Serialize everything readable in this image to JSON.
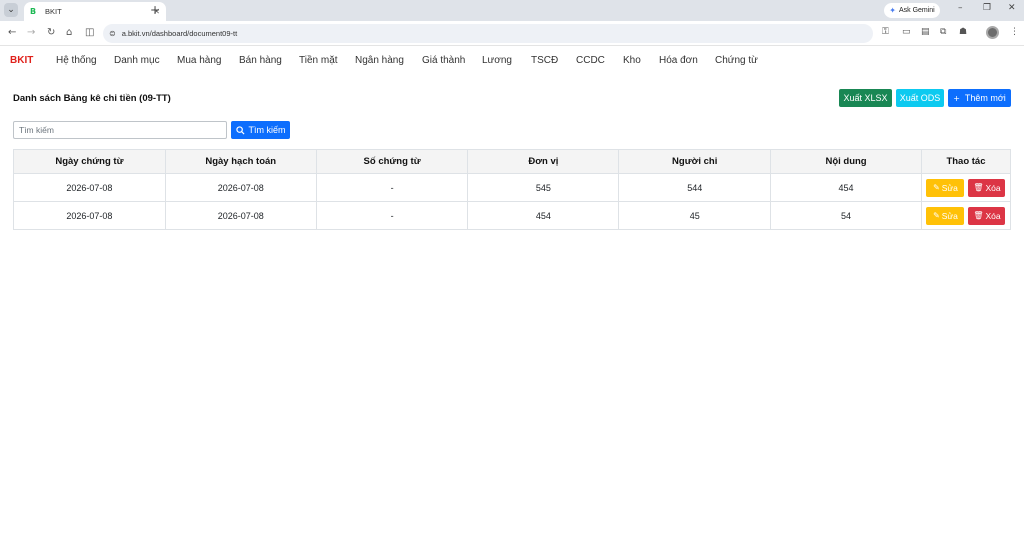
{
  "browser": {
    "tab_title": "BKIT",
    "favicon": "B",
    "url": "a.bkit.vn/dashboard/document09-tt",
    "gemini_label": "Ask Gemini"
  },
  "app": {
    "brand": "BKIT",
    "brand_color": "#e0211b",
    "menu": [
      "Hệ thống",
      "Danh mục",
      "Mua hàng",
      "Bán hàng",
      "Tiền mặt",
      "Ngân hàng",
      "Giá thành",
      "Lương",
      "TSCĐ",
      "CCDC",
      "Kho",
      "Hóa đơn",
      "Chứng từ"
    ]
  },
  "page": {
    "title": "Danh sách Bảng kê chi tiền (09-TT)",
    "export_xlsx": "Xuất XLSX",
    "export_ods": "Xuất ODS",
    "add_new": "Thêm mới",
    "search_placeholder": "Tìm kiếm",
    "search_button": "Tìm kiếm"
  },
  "table": {
    "headers": [
      "Ngày chứng từ",
      "Ngày hạch toán",
      "Số chứng từ",
      "Đơn vị",
      "Người chi",
      "Nội dung",
      "Thao tác"
    ],
    "rows": [
      [
        "2026-07-08",
        "2026-07-08",
        "-",
        "545",
        "544",
        "454"
      ],
      [
        "2026-07-08",
        "2026-07-08",
        "-",
        "454",
        "45",
        "54"
      ]
    ],
    "edit_label": "Sửa",
    "delete_label": "Xóa"
  },
  "colors": {
    "success": "#198754",
    "info": "#0dcaf0",
    "primary": "#0d6efd",
    "warning": "#ffc107",
    "danger": "#dc3545"
  }
}
